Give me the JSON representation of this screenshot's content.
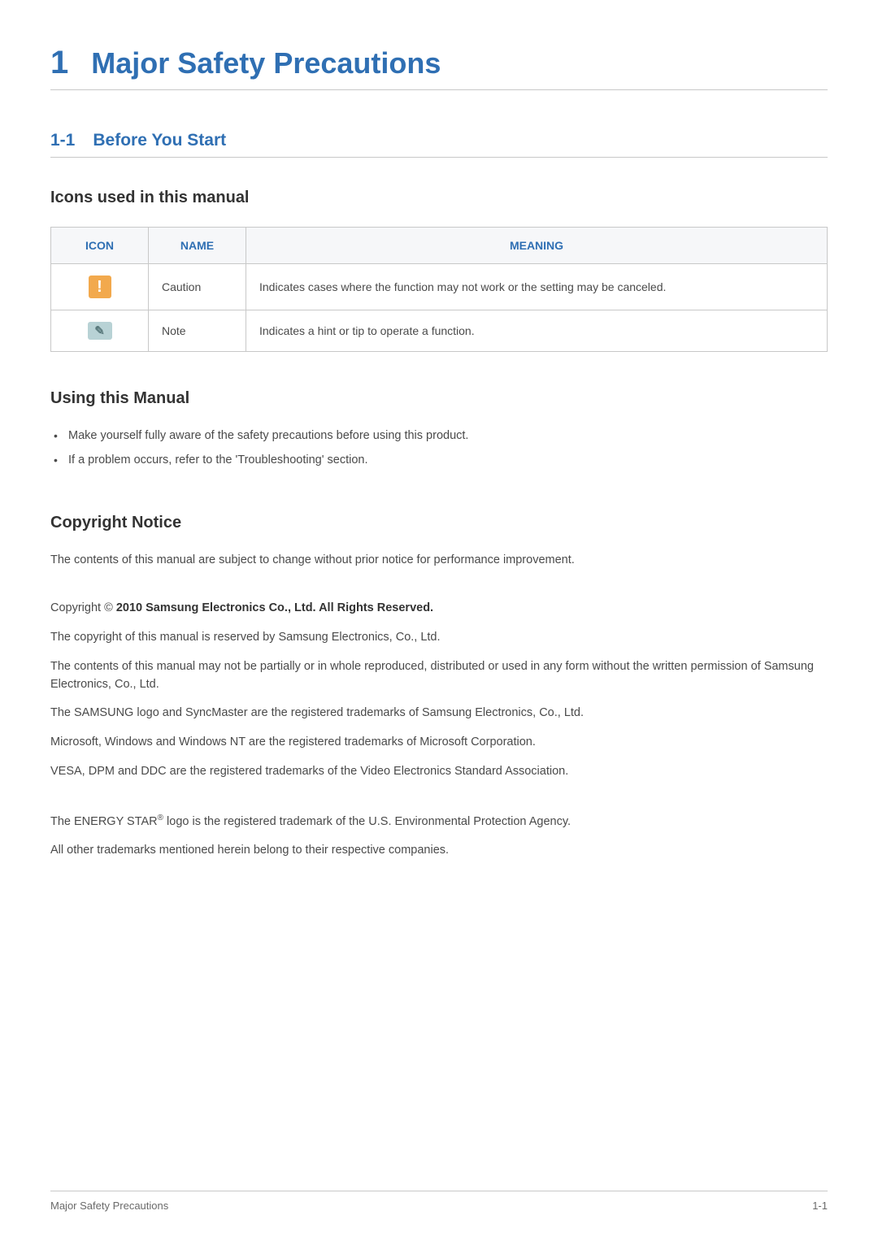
{
  "chapter": {
    "number": "1",
    "title": "Major Safety Precautions"
  },
  "section": {
    "number": "1-1",
    "title": "Before You Start"
  },
  "icons_heading": "Icons used in this manual",
  "table": {
    "headers": {
      "icon": "ICON",
      "name": "NAME",
      "meaning": "MEANING"
    },
    "rows": [
      {
        "glyph": "!",
        "name": "Caution",
        "meaning": "Indicates cases where the function may not work or the setting may be canceled."
      },
      {
        "glyph": "✎",
        "name": "Note",
        "meaning": "Indicates a hint or tip to operate a function."
      }
    ]
  },
  "using_heading": "Using this Manual",
  "using_bullets": [
    "Make yourself fully aware of the safety precautions before using this product.",
    "If a problem occurs, refer to the 'Troubleshooting' section."
  ],
  "copyright_heading": "Copyright Notice",
  "copyright_intro": "The contents of this manual are subject to change without prior notice for performance improvement.",
  "copyright_line_prefix": "Copyright © ",
  "copyright_line_bold": "2010 Samsung Electronics Co., Ltd. All Rights Reserved.",
  "para1": "The copyright of this manual is reserved by Samsung Electronics, Co., Ltd.",
  "para2": "The contents of this manual may not be partially or in whole reproduced, distributed or used in any form without the written permission of Samsung Electronics, Co., Ltd.",
  "para3": "The SAMSUNG logo and SyncMaster are the registered trademarks of Samsung Electronics, Co., Ltd.",
  "para4": "Microsoft, Windows and Windows NT are the registered trademarks of Microsoft Corporation.",
  "para5": "VESA, DPM and DDC are the registered trademarks of the Video Electronics Standard Association.",
  "energy_pre": "The ENERGY STAR",
  "energy_sup": "®",
  "energy_post": " logo is the registered trademark of the U.S. Environmental Protection Agency.",
  "para7": "All other trademarks mentioned herein belong to their respective companies.",
  "footer": {
    "left": "Major Safety Precautions",
    "right": "1-1"
  }
}
